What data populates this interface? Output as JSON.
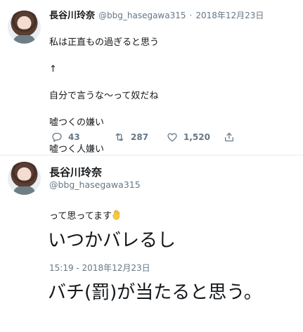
{
  "tweet1": {
    "author_name": "長谷川玲奈",
    "handle": "@bbg_hasegawa315",
    "separator": "·",
    "date": "2018年12月23日",
    "lines": [
      "私は正直もの過ぎると思う",
      "↑",
      "自分で言うな〜って奴だね",
      "嘘つくの嫌い",
      "嘘つく人嫌い",
      "",
      "って思ってます"
    ],
    "emoji_icon": "raised-hand-emoji",
    "reply_count": "43",
    "retweet_count": "287",
    "like_count": "1,520"
  },
  "tweet2": {
    "author_name": "長谷川玲奈",
    "handle": "@bbg_hasegawa315",
    "line1": "いつかバレるし",
    "line2": "バチ(罰)が当たると思う。",
    "timestamp": "15:19 - 2018年12月23日"
  },
  "colors": {
    "text": "#14171a",
    "secondary": "#657786",
    "divider": "#e6ecf0",
    "emoji": "#f7c948"
  }
}
